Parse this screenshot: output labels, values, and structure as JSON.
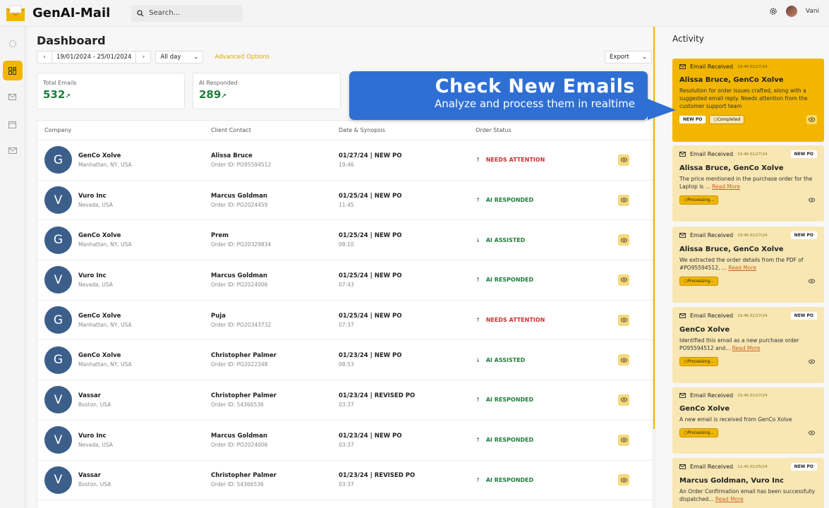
{
  "app": {
    "title": "GenAI-Mail"
  },
  "search": {
    "placeholder": "Search..."
  },
  "user": {
    "name": "Vani"
  },
  "dashboard": {
    "title": "Dashboard",
    "date_range": "19/01/2024 - 25/01/2024",
    "period": "All day",
    "advanced_options": "Advanced Options",
    "export": "Export"
  },
  "stats": [
    {
      "label": "Total Emails",
      "value": "532"
    },
    {
      "label": "AI Responded",
      "value": "289"
    }
  ],
  "table": {
    "headers": {
      "company": "Company",
      "contact": "Client Contact",
      "date": "Date & Synopsis",
      "status": "Order Status"
    },
    "rows": [
      {
        "initial": "G",
        "company": "GenCo Xolve",
        "location": "Manhattan, NY, USA",
        "contact": "Alissa Bruce",
        "order": "Order ID: PO95594512",
        "date": "01/27/24 | NEW PO",
        "time": "19:46",
        "status": "NEEDS ATTENTION",
        "dir": "↑"
      },
      {
        "initial": "V",
        "company": "Vuro Inc",
        "location": "Nevada, USA",
        "contact": "Marcus Goldman",
        "order": "Order ID: PO2024459",
        "date": "01/25/24 | NEW PO",
        "time": "11:45",
        "status": "AI RESPONDED",
        "dir": "↑"
      },
      {
        "initial": "G",
        "company": "GenCo Xolve",
        "location": "Manhattan, NY, USA",
        "contact": "Prem",
        "order": "Order ID: PO20329834",
        "date": "01/25/24 | NEW PO",
        "time": "08:10",
        "status": "AI ASSISTED",
        "dir": "↓"
      },
      {
        "initial": "V",
        "company": "Vuro Inc",
        "location": "Nevada, USA",
        "contact": "Marcus Goldman",
        "order": "Order ID: PO2024006",
        "date": "01/25/24 | NEW PO",
        "time": "07:43",
        "status": "AI RESPONDED",
        "dir": "↑"
      },
      {
        "initial": "G",
        "company": "GenCo Xolve",
        "location": "Manhattan, NY, USA",
        "contact": "Puja",
        "order": "Order ID: PO20343732",
        "date": "01/25/24 | NEW PO",
        "time": "07:37",
        "status": "NEEDS ATTENTION",
        "dir": "↑"
      },
      {
        "initial": "G",
        "company": "GenCo Xolve",
        "location": "Manhattan, NY, USA",
        "contact": "Christopher Palmer",
        "order": "Order ID: PO2022348",
        "date": "01/23/24 | NEW PO",
        "time": "08:53",
        "status": "AI ASSISTED",
        "dir": "↓"
      },
      {
        "initial": "V",
        "company": "Vassar",
        "location": "Boston, USA",
        "contact": "Christopher Palmer",
        "order": "Order ID: 54366536",
        "date": "01/23/24 | REVISED PO",
        "time": "03:37",
        "status": "AI RESPONDED",
        "dir": "↑"
      },
      {
        "initial": "V",
        "company": "Vuro Inc",
        "location": "Nevada, USA",
        "contact": "Marcus Goldman",
        "order": "Order ID: PO2024006",
        "date": "01/23/24 | NEW PO",
        "time": "03:37",
        "status": "AI RESPONDED",
        "dir": "↑"
      },
      {
        "initial": "V",
        "company": "Vassar",
        "location": "Boston, USA",
        "contact": "Christopher Palmer",
        "order": "Order ID: 54366536",
        "date": "01/23/24 | REVISED PO",
        "time": "03:37",
        "status": "AI RESPONDED",
        "dir": "↑"
      }
    ]
  },
  "callout": {
    "headline": "Check New Emails",
    "subline": "Analyze and process them in realtime"
  },
  "activity": {
    "title": "Activity",
    "cards": [
      {
        "head": "Email Received",
        "ts": "19:46 01/27/24",
        "tag": "",
        "title": "Alissa Bruce, GenCo Xolve",
        "body": "Resolution for order issues crafted, along with a suggested email reply. Needs attention from the customer support team",
        "more": "",
        "tags": [
          "NEW PO"
        ],
        "state": "Completed"
      },
      {
        "head": "Email Received",
        "ts": "19:46 01/27/24",
        "tag": "NEW PO",
        "title": "Alissa Bruce, GenCo Xolve",
        "body": "The price mentioned in the purchase order for the Laptop is ...",
        "more": "Read More",
        "state": "Processing..."
      },
      {
        "head": "Email Received",
        "ts": "19:46 01/27/24",
        "tag": "NEW PO",
        "title": "Alissa Bruce, GenCo Xolve",
        "body": "We extracted the order details from the PDF of #PO95594512, ...",
        "more": "Read More",
        "state": "Processing..."
      },
      {
        "head": "Email Received",
        "ts": "19:46 01/27/24",
        "tag": "NEW PO",
        "title": "GenCo Xolve",
        "body": "Identified this email as a new purchase order PO95594512 and...",
        "more": "Read More",
        "state": "Processing..."
      },
      {
        "head": "Email Received",
        "ts": "19:46 01/27/24",
        "tag": "",
        "title": "GenCo Xolve",
        "body": "A new email is received from GenCo Xolve",
        "more": "",
        "state": "Processing..."
      },
      {
        "head": "Email Received",
        "ts": "11:45 01/25/24",
        "tag": "NEW PO",
        "title": "Marcus Goldman, Vuro Inc",
        "body": "An Order Confirmation email has been successfully dispatched...",
        "more": "Read More",
        "state": ""
      }
    ]
  },
  "colors": {
    "accent": "#f2b600",
    "callout": "#2f6fd4",
    "avatar_bg": "#3b5e8a",
    "attention": "#c8312e",
    "responded": "#1e7d3c"
  }
}
